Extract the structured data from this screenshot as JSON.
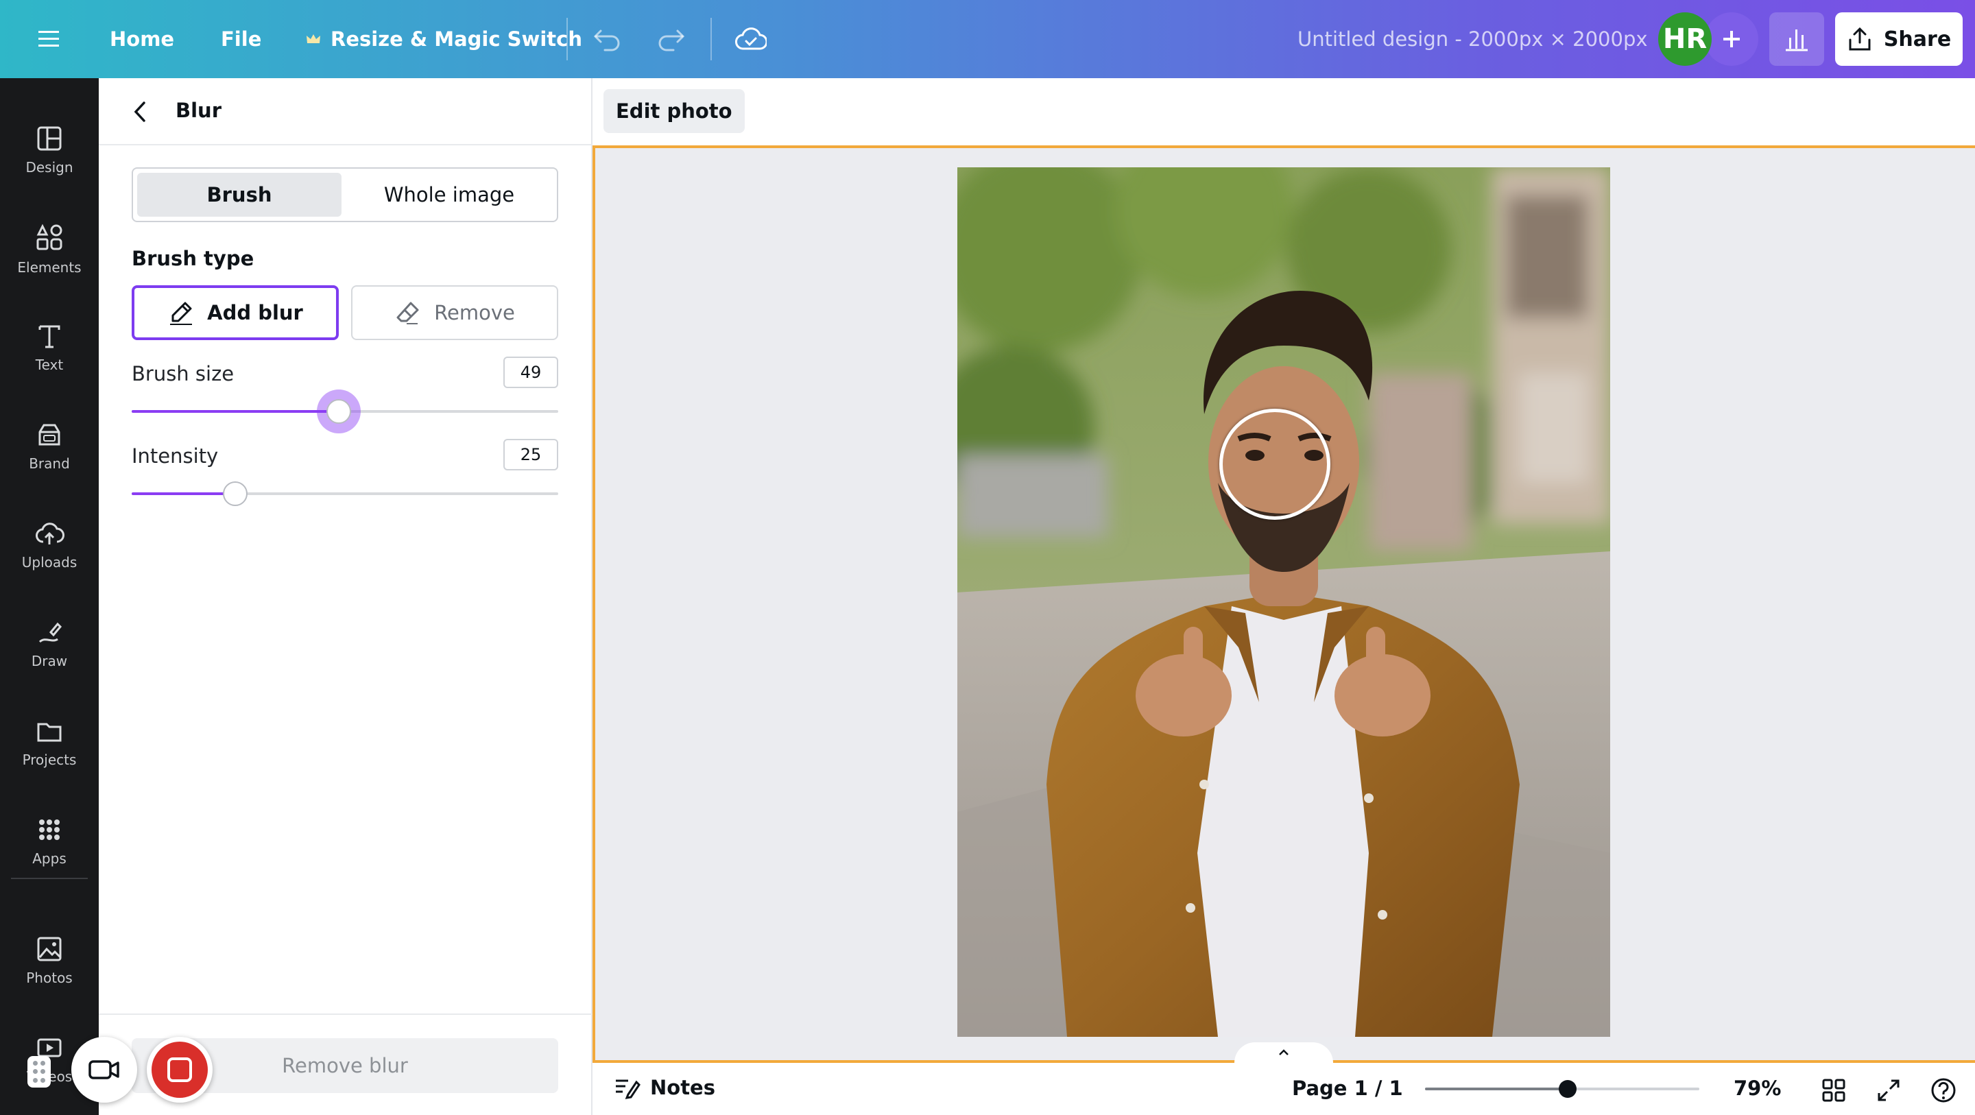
{
  "topbar": {
    "home": "Home",
    "file": "File",
    "resize": "Resize & Magic Switch",
    "design_title": "Untitled design - 2000px × 2000px",
    "avatar_initials": "HR",
    "share": "Share"
  },
  "rail": {
    "items": [
      {
        "label": "Design",
        "icon": "design-icon"
      },
      {
        "label": "Elements",
        "icon": "elements-icon"
      },
      {
        "label": "Text",
        "icon": "text-icon"
      },
      {
        "label": "Brand",
        "icon": "brand-icon"
      },
      {
        "label": "Uploads",
        "icon": "uploads-icon"
      },
      {
        "label": "Draw",
        "icon": "draw-icon"
      },
      {
        "label": "Projects",
        "icon": "projects-icon"
      },
      {
        "label": "Apps",
        "icon": "apps-icon"
      },
      {
        "label": "Photos",
        "icon": "photos-icon"
      },
      {
        "label": "Videos",
        "icon": "videos-icon"
      }
    ]
  },
  "panel": {
    "title": "Blur",
    "mode_tabs": [
      "Brush",
      "Whole image"
    ],
    "active_mode": "Brush",
    "brush_type_label": "Brush type",
    "add_blur": "Add blur",
    "remove": "Remove",
    "brush_size_label": "Brush size",
    "brush_size": 49,
    "intensity_label": "Intensity",
    "intensity": 25,
    "remove_blur": "Remove blur"
  },
  "editor": {
    "edit_photo": "Edit photo"
  },
  "bottombar": {
    "notes": "Notes",
    "page": "Page 1 / 1",
    "zoom_label": "79%",
    "zoom_fraction": 0.52
  },
  "colors": {
    "accent": "#7d3cf0",
    "selection": "#f2a93b",
    "record": "#d92f2a"
  }
}
